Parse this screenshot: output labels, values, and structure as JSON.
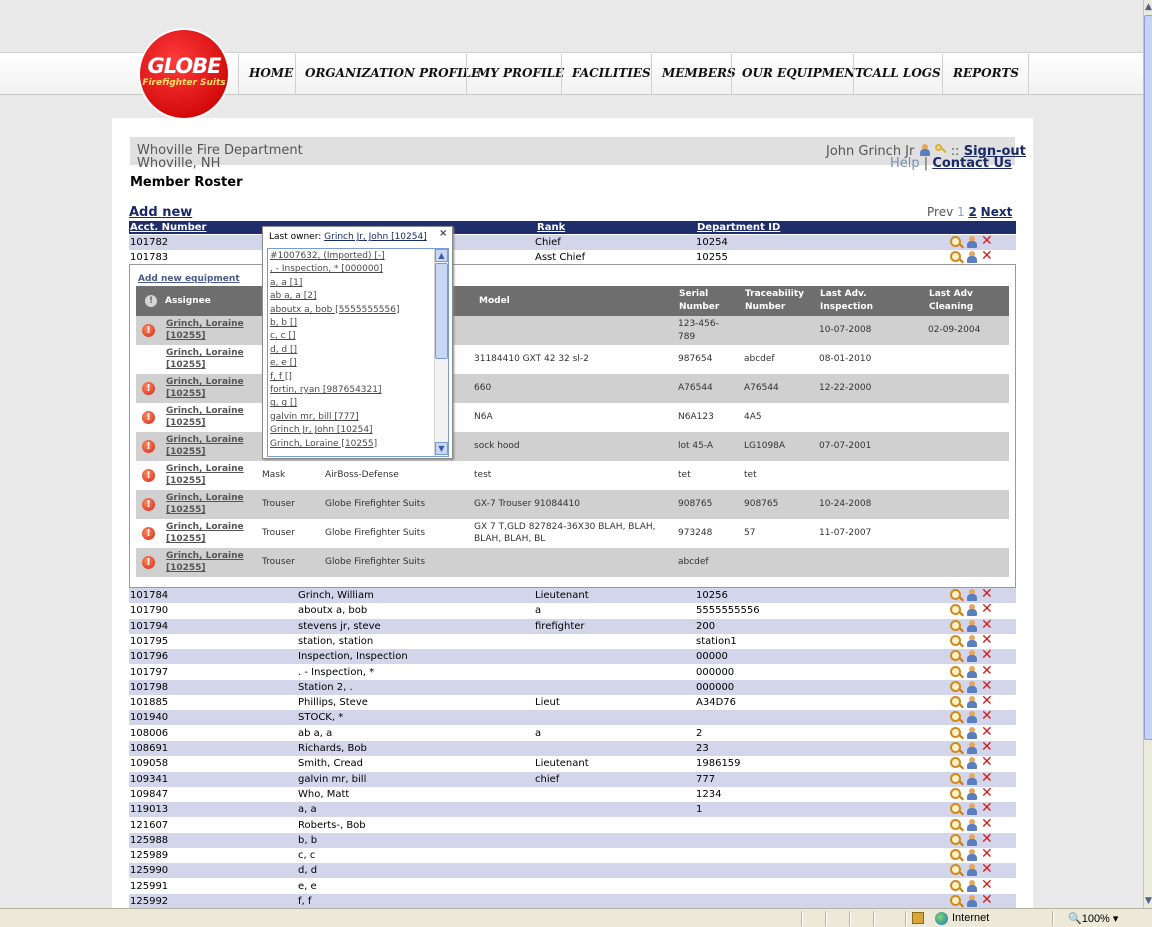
{
  "logo": {
    "line1": "GLOBE",
    "line2": "Firefighter Suits"
  },
  "nav": [
    "HOME",
    "ORGANIZATION PROFILE",
    "MY PROFILE",
    "FACILITIES",
    "MEMBERS",
    "OUR EQUIPMENT",
    "CALL LOGS",
    "REPORTS"
  ],
  "dept": {
    "name": "Whoville Fire Department",
    "location": "Whoville, NH"
  },
  "user": {
    "name": "John Grinch Jr",
    "sep": "::",
    "signout": "Sign-out",
    "help": "Help",
    "pipe": "|",
    "contact": "Contact Us"
  },
  "page_title": "Member Roster",
  "add_new": "Add new",
  "pager": {
    "prev": "Prev",
    "p1": "1",
    "p2": "2",
    "next": "Next"
  },
  "columns": {
    "acct": "Acct. Number",
    "rank": "Rank",
    "dept_id": "Department ID"
  },
  "top_rows": [
    {
      "acct": "101782",
      "rank": "Chief",
      "dept_id": "10254"
    },
    {
      "acct": "101783",
      "rank": "Asst Chief",
      "dept_id": "10255"
    }
  ],
  "equipment": {
    "add_label": "Add new equipment",
    "headers": {
      "assignee": "Assignee",
      "model": "Model",
      "serial1": "Serial",
      "serial2": "Number",
      "trace1": "Traceability",
      "trace2": "Number",
      "insp1": "Last Adv.",
      "insp2": "Inspection",
      "clean1": "Last Adv",
      "clean2": "Cleaning"
    },
    "rows": [
      {
        "a1": "Grinch, Loraine",
        "a2": "[10255]",
        "type": "",
        "brand": "",
        "model": "",
        "serial": "123-456-",
        "serial2": "789",
        "trace": "",
        "insp": "10-07-2008",
        "clean": "02-09-2004",
        "warn": true
      },
      {
        "a1": "Grinch, Loraine",
        "a2": "[10255]",
        "type": "",
        "brand": "",
        "model": "31184410 GXT 42 32 sl-2",
        "serial": "987654",
        "serial2": "",
        "trace": "abcdef",
        "insp": "08-01-2010",
        "clean": "",
        "warn": false
      },
      {
        "a1": "Grinch, Loraine",
        "a2": "[10255]",
        "type": "",
        "brand": "",
        "model": "660",
        "serial": "A76544",
        "serial2": "",
        "trace": "A76544",
        "insp": "12-22-2000",
        "clean": "",
        "warn": true
      },
      {
        "a1": "Grinch, Loraine",
        "a2": "[10255]",
        "type": "",
        "brand": "",
        "model": "N6A",
        "serial": "N6A123",
        "serial2": "",
        "trace": "4A5",
        "insp": "",
        "clean": "",
        "warn": true
      },
      {
        "a1": "Grinch, Loraine",
        "a2": "[10255]",
        "type": "",
        "brand": "",
        "model": "sock hood",
        "serial": "lot 45-A",
        "serial2": "",
        "trace": "LG1098A",
        "insp": "07-07-2001",
        "clean": "",
        "warn": true
      },
      {
        "a1": "Grinch, Loraine",
        "a2": "[10255]",
        "type": "Mask",
        "brand": "AirBoss-Defense",
        "model": "test",
        "serial": "tet",
        "serial2": "",
        "trace": "tet",
        "insp": "",
        "clean": "",
        "warn": true
      },
      {
        "a1": "Grinch, Loraine",
        "a2": "[10255]",
        "type": "Trouser",
        "brand": "Globe Firefighter Suits",
        "model": "GX-7 Trouser 91084410",
        "serial": "908765",
        "serial2": "",
        "trace": "908765",
        "insp": "10-24-2008",
        "clean": "",
        "warn": true
      },
      {
        "a1": "Grinch, Loraine",
        "a2": "[10255]",
        "type": "Trouser",
        "brand": "Globe Firefighter Suits",
        "model": "GX 7 T,GLD 827824-36X30 BLAH, BLAH,",
        "model2": "BLAH, BLAH, BL",
        "serial": "973248",
        "serial2": "",
        "trace": "57",
        "insp": "11-07-2007",
        "clean": "",
        "warn": true
      },
      {
        "a1": "Grinch, Loraine",
        "a2": "[10255]",
        "type": "Trouser",
        "brand": "Globe Firefighter Suits",
        "model": "",
        "serial": "abcdef",
        "serial2": "",
        "trace": "",
        "insp": "",
        "clean": "",
        "warn": true
      }
    ]
  },
  "popup": {
    "label": "Last owner:",
    "owner": "Grinch Jr, John [10254]",
    "close": "×",
    "items": [
      "#1007632, (Imported) [-]",
      ", - Inspection, * [000000]",
      "a, a [1]",
      "ab a, a [2]",
      "aboutx a, bob [5555555556]",
      "b, b []",
      "c, c []",
      "d, d []",
      "e, e []",
      "f, f []",
      "fortin, ryan [987654321]",
      "g, g []",
      "galvin mr, bill [777]",
      "Grinch Jr, John [10254]",
      "Grinch, Loraine [10255]"
    ]
  },
  "members": [
    {
      "acct": "101784",
      "name": "Grinch, William",
      "rank": "Lieutenant",
      "dept_id": "10256"
    },
    {
      "acct": "101790",
      "name": "aboutx a, bob",
      "rank": "a",
      "dept_id": "5555555556"
    },
    {
      "acct": "101794",
      "name": "stevens jr, steve",
      "rank": "firefighter",
      "dept_id": "200"
    },
    {
      "acct": "101795",
      "name": "station, station",
      "rank": "",
      "dept_id": "station1"
    },
    {
      "acct": "101796",
      "name": "Inspection, Inspection",
      "rank": "",
      "dept_id": "00000"
    },
    {
      "acct": "101797",
      "name": ". - Inspection, *",
      "rank": "",
      "dept_id": "000000"
    },
    {
      "acct": "101798",
      "name": "Station 2, .",
      "rank": "",
      "dept_id": "000000"
    },
    {
      "acct": "101885",
      "name": "Phillips, Steve",
      "rank": "Lieut",
      "dept_id": "A34D76"
    },
    {
      "acct": "101940",
      "name": "STOCK, *",
      "rank": "",
      "dept_id": ""
    },
    {
      "acct": "108006",
      "name": "ab a, a",
      "rank": "a",
      "dept_id": "2"
    },
    {
      "acct": "108691",
      "name": "Richards, Bob",
      "rank": "",
      "dept_id": "23"
    },
    {
      "acct": "109058",
      "name": "Smith, Cread",
      "rank": "Lieutenant",
      "dept_id": "1986159"
    },
    {
      "acct": "109341",
      "name": "galvin mr, bill",
      "rank": "chief",
      "dept_id": "777"
    },
    {
      "acct": "109847",
      "name": "Who, Matt",
      "rank": "",
      "dept_id": "1234"
    },
    {
      "acct": "119013",
      "name": "a, a",
      "rank": "",
      "dept_id": "1"
    },
    {
      "acct": "121607",
      "name": "Roberts-, Bob",
      "rank": "",
      "dept_id": ""
    },
    {
      "acct": "125988",
      "name": "b, b",
      "rank": "",
      "dept_id": ""
    },
    {
      "acct": "125989",
      "name": "c, c",
      "rank": "",
      "dept_id": ""
    },
    {
      "acct": "125990",
      "name": "d, d",
      "rank": "",
      "dept_id": ""
    },
    {
      "acct": "125991",
      "name": "e, e",
      "rank": "",
      "dept_id": ""
    },
    {
      "acct": "125992",
      "name": "f, f",
      "rank": "",
      "dept_id": ""
    }
  ],
  "status": {
    "zone": "Internet",
    "zoom": "100%"
  }
}
